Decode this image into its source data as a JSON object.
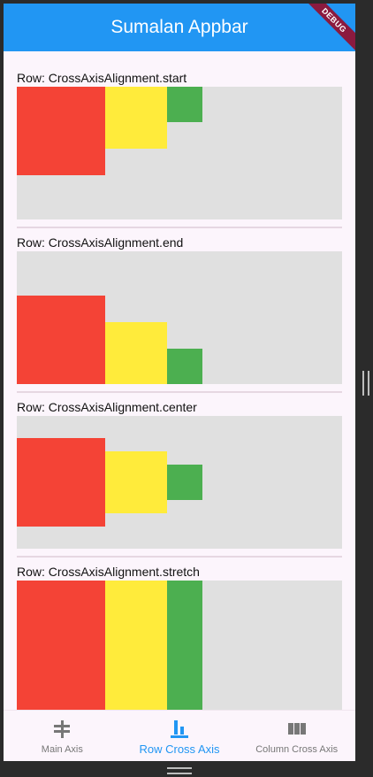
{
  "appbar": {
    "title": "Sumalan Appbar",
    "debug_label": "DEBUG"
  },
  "sections": [
    {
      "label": "Row: CrossAxisAlignment.start"
    },
    {
      "label": "Row: CrossAxisAlignment.end"
    },
    {
      "label": "Row: CrossAxisAlignment.center"
    },
    {
      "label": "Row: CrossAxisAlignment.stretch"
    }
  ],
  "bottom_nav": {
    "items": [
      {
        "label": "Main Axis",
        "icon": "main-axis-icon",
        "active": false
      },
      {
        "label": "Row Cross Axis",
        "icon": "row-cross-axis-icon",
        "active": true
      },
      {
        "label": "Column Cross Axis",
        "icon": "column-cross-axis-icon",
        "active": false
      }
    ]
  },
  "colors": {
    "appbar": "#2196f3",
    "red": "#f44336",
    "yellow": "#ffeb3b",
    "green": "#4caf50",
    "container": "#e0e0e0",
    "active_nav": "#2196f3"
  }
}
